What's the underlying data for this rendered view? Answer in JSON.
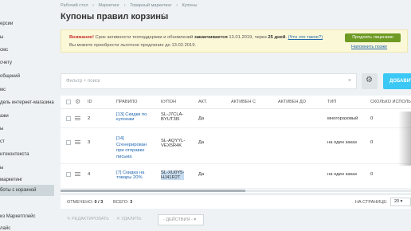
{
  "sidebar": {
    "items": [
      {
        "label": "ерсии"
      },
      {
        "label": "ы"
      },
      {
        "label": "смс"
      },
      {
        "label": "счету"
      },
      {
        "label": "общений"
      },
      {
        "label": "мс"
      },
      {
        "label": "дель интернет-магазина"
      },
      {
        "label": "ажи"
      },
      {
        "label": "ы"
      },
      {
        "label": "ст"
      },
      {
        "label": "нтоконтекста"
      },
      {
        "label": "ы"
      },
      {
        "label": "маркетинг"
      },
      {
        "label": "нальный список маркет"
      },
      {
        "label": "боты с корзиной"
      },
      {
        "label": "из Маркетплейс"
      },
      {
        "label": "лайс"
      }
    ]
  },
  "breadcrumb": [
    "Рабочий стол",
    "Маркетинг",
    "Товарный маркетинг",
    "Купоны"
  ],
  "page_title": "Купоны правил корзины",
  "star_icon": "star-icon",
  "notice": {
    "warning": "Внимание!",
    "text1": " Срок активности техподдержки и обновлений ",
    "strong1": "заканчивается",
    "text2": " 13.01.2019, через ",
    "strong2": "25 дней",
    "text3": ". ",
    "link1": "(Что это такое?)",
    "line2": "Вы можете приобрести льготное продление до 13.02.2019.",
    "prolong_button": "Продлить лицензию",
    "later_link": "Напомнить позже"
  },
  "filter": {
    "placeholder": "Фильтр + поиск",
    "clear": "×"
  },
  "add_button": "ДОБАВИТЬ",
  "table": {
    "columns": {
      "id": "ID",
      "rule": "ПРАВИЛО",
      "coupon": "КУПОН",
      "active": "АКТ.",
      "active_from": "АКТИВЕН С",
      "active_to": "АКТИВЕН ДО",
      "type": "ТИП",
      "uses": "СКОЛЬКО ИСПОЛЬЗ"
    },
    "rows": [
      {
        "id": "2",
        "rule": [
          "[13] Скидки по",
          "купонам"
        ],
        "coupon": [
          "SL-J7CLA-",
          "BYUT3I5"
        ],
        "active": "Да",
        "type": "многоразовый",
        "uses": "0"
      },
      {
        "id": "3",
        "rule": [
          "[14]",
          "Сгенерирован",
          "при отправке",
          "письма"
        ],
        "coupon": [
          "SL-AQYYL-",
          "VEX5R4K"
        ],
        "active": "Да",
        "type": "на один заказ",
        "uses": "0"
      },
      {
        "id": "4",
        "rule": [
          "[7] Скидка на",
          "товары 20%"
        ],
        "coupon": [
          "SL-XU0Y5-",
          "HJ41R2T"
        ],
        "active": "Да",
        "type": "на один заказ",
        "uses": "0"
      }
    ]
  },
  "footer": {
    "selected_label": "ОТМЕЧЕНО:",
    "selected_value": "0 / 3",
    "total_label": "ВСЕГО:",
    "total_value": "3",
    "per_page_label": "НА СТРАНИЦЕ:",
    "per_page_value": "20"
  },
  "actions": {
    "edit": "✎ РЕДАКТИРОВАТЬ",
    "delete": "✕ УДАЛИТЬ",
    "select": "- ДЕЙСТВИЯ -"
  }
}
